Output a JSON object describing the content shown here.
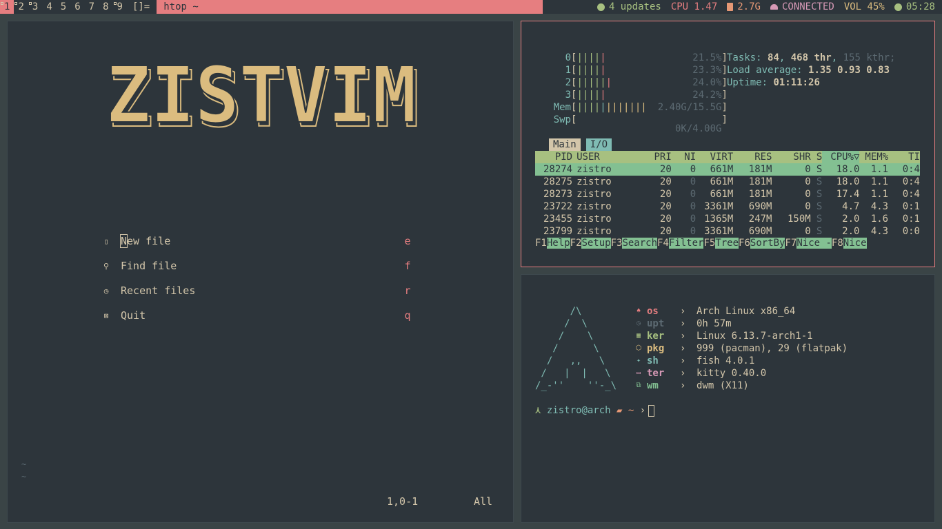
{
  "bar": {
    "tags": [
      "1",
      "2",
      "3",
      "4",
      "5",
      "6",
      "7",
      "8",
      "9"
    ],
    "active_tag": "1",
    "layout_symbol": "[]=",
    "window_title": "htop ~",
    "status": {
      "updates": "4 updates",
      "cpu": "CPU 1.47",
      "mem": "2.7G",
      "network": "CONNECTED",
      "volume": "VOL 45%",
      "clock": "05:28"
    }
  },
  "vim": {
    "logo_text": "ZISTVIM",
    "menu": [
      {
        "icon": "new-file-icon",
        "glyph": "▯",
        "label": "New file",
        "key": "e"
      },
      {
        "icon": "find-file-icon",
        "glyph": "⚲",
        "label": "Find file",
        "key": "f"
      },
      {
        "icon": "recent-files-icon",
        "glyph": "◷",
        "label": "Recent files",
        "key": "r"
      },
      {
        "icon": "quit-icon",
        "glyph": "⊠",
        "label": "Quit",
        "key": "q"
      }
    ],
    "tildes": [
      "~",
      "~"
    ],
    "ruler_position": "1,0-1",
    "ruler_scroll": "All"
  },
  "htop": {
    "cpus": [
      {
        "label": "0",
        "bars": "|||||",
        "value": "21.5%"
      },
      {
        "label": "1",
        "bars": "|||||",
        "value": "23.3%"
      },
      {
        "label": "2",
        "bars": "||||||",
        "value": "24.0%"
      },
      {
        "label": "3",
        "bars": "|||||",
        "value": "24.2%"
      }
    ],
    "mem": {
      "label": "Mem",
      "bars": "||||||||||||",
      "value": "2.40G/15.5G"
    },
    "swp": {
      "label": "Swp",
      "bars": "",
      "value": "0K/4.00G"
    },
    "tasks_label": "Tasks:",
    "tasks": "84",
    "threads": "468 thr",
    "kthreads": "155 kthr",
    "load_label": "Load average:",
    "load": "1.35 0.93 0.83",
    "uptime_label": "Uptime:",
    "uptime": "01:11:26",
    "tabs": [
      "Main",
      "I/O"
    ],
    "columns": [
      "PID",
      "USER",
      "PRI",
      "NI",
      "VIRT",
      "RES",
      "SHR",
      "S",
      "CPU%▽",
      "MEM%",
      "TI"
    ],
    "rows": [
      [
        "28274",
        "zistro",
        "20",
        "0",
        "661M",
        "181M",
        "0",
        "S",
        "18.0",
        "1.1",
        "0:4"
      ],
      [
        "28275",
        "zistro",
        "20",
        "0",
        "661M",
        "181M",
        "0",
        "S",
        "18.0",
        "1.1",
        "0:4"
      ],
      [
        "28273",
        "zistro",
        "20",
        "0",
        "661M",
        "181M",
        "0",
        "S",
        "17.4",
        "1.1",
        "0:4"
      ],
      [
        "23722",
        "zistro",
        "20",
        "0",
        "3361M",
        "690M",
        "0",
        "S",
        "4.7",
        "4.3",
        "0:1"
      ],
      [
        "23455",
        "zistro",
        "20",
        "0",
        "1365M",
        "247M",
        "150M",
        "S",
        "2.0",
        "1.6",
        "0:1"
      ],
      [
        "23799",
        "zistro",
        "20",
        "0",
        "3361M",
        "690M",
        "0",
        "S",
        "2.0",
        "4.3",
        "0:0"
      ]
    ],
    "fkeys": [
      {
        "num": "F1",
        "label": "Help  "
      },
      {
        "num": "F2",
        "label": "Setup "
      },
      {
        "num": "F3",
        "label": "Search"
      },
      {
        "num": "F4",
        "label": "Filter"
      },
      {
        "num": "F5",
        "label": "Tree  "
      },
      {
        "num": "F6",
        "label": "SortBy"
      },
      {
        "num": "F7",
        "label": "Nice -"
      },
      {
        "num": "F8",
        "label": "Nice"
      }
    ]
  },
  "terminal": {
    "art": "      /\\\n     /  \\\n    /    \\\n   /      \\\n  /   ,,   \\\n /   |  |   \\\n/_-''    ''-_\\",
    "fetch": [
      {
        "icon": "os-icon",
        "glyph": "♠",
        "key": "os",
        "color": "#e67e80",
        "arrow": "›",
        "value": "Arch Linux x86_64"
      },
      {
        "icon": "uptime-icon",
        "glyph": "◷",
        "key": "upt",
        "color": "#5c6a72",
        "arrow": "›",
        "value": "0h 57m"
      },
      {
        "icon": "kernel-icon",
        "glyph": "▦",
        "key": "ker",
        "color": "#a7c080",
        "arrow": "›",
        "value": "Linux 6.13.7-arch1-1"
      },
      {
        "icon": "package-icon",
        "glyph": "⬡",
        "key": "pkg",
        "color": "#dbbc7f",
        "arrow": "›",
        "value": "999 (pacman), 29 (flatpak)"
      },
      {
        "icon": "shell-icon",
        "glyph": "✦",
        "key": "sh",
        "color": "#7fbbb3",
        "arrow": "›",
        "value": "fish 4.0.1"
      },
      {
        "icon": "terminal-icon",
        "glyph": "▭",
        "key": "ter",
        "color": "#d699b6",
        "arrow": "›",
        "value": "kitty 0.40.0"
      },
      {
        "icon": "wm-icon",
        "glyph": "⧉",
        "key": "wm",
        "color": "#83c092",
        "arrow": "›",
        "value": "dwm (X11)"
      }
    ],
    "prompt": {
      "symbol": "⋏",
      "user": "zistro@arch",
      "folder_glyph": "▰",
      "dir": "~",
      "caret": "›"
    }
  }
}
